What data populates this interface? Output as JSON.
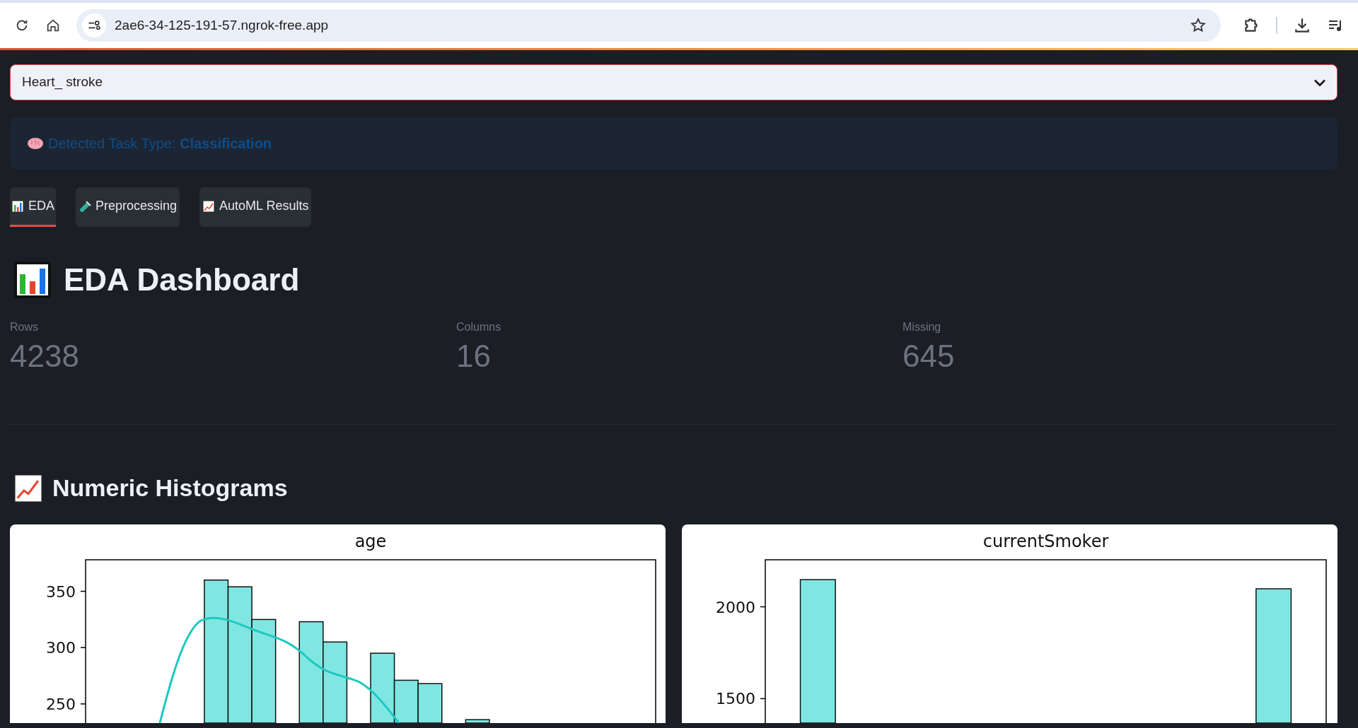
{
  "browser": {
    "url": "2ae6-34-125-191-57.ngrok-free.app"
  },
  "target_select": {
    "value": "Heart_ stroke"
  },
  "info": {
    "text": "Detected Task Type: **Classification**"
  },
  "tabs": [
    {
      "label": "EDA",
      "selected": true
    },
    {
      "label": "Preprocessing",
      "selected": false
    },
    {
      "label": "AutoML Results",
      "selected": false
    }
  ],
  "heading": "EDA Dashboard",
  "metrics": [
    {
      "label": "Rows",
      "value": "4238"
    },
    {
      "label": "Columns",
      "value": "16"
    },
    {
      "label": "Missing",
      "value": "645"
    }
  ],
  "section_heading": "Numeric Histograms",
  "charts": [
    {
      "kde": true,
      "chart_data": {
        "type": "bar",
        "title": "age",
        "ylim": [
          233,
          378
        ],
        "yticks": [
          250,
          300,
          350
        ],
        "values": [
          null,
          null,
          null,
          null,
          null,
          360,
          354,
          325,
          null,
          323,
          305,
          null,
          295,
          271,
          268,
          null,
          236,
          null,
          null,
          null,
          null,
          null,
          null,
          null
        ]
      }
    },
    {
      "kde": false,
      "chart_data": {
        "type": "bar",
        "title": "currentSmoker",
        "ylim": [
          1367,
          2256
        ],
        "yticks": [
          1500,
          2000
        ],
        "values": [
          null,
          2148,
          null,
          null,
          null,
          null,
          null,
          null,
          null,
          null,
          null,
          null,
          null,
          null,
          2098,
          null
        ]
      }
    }
  ]
}
